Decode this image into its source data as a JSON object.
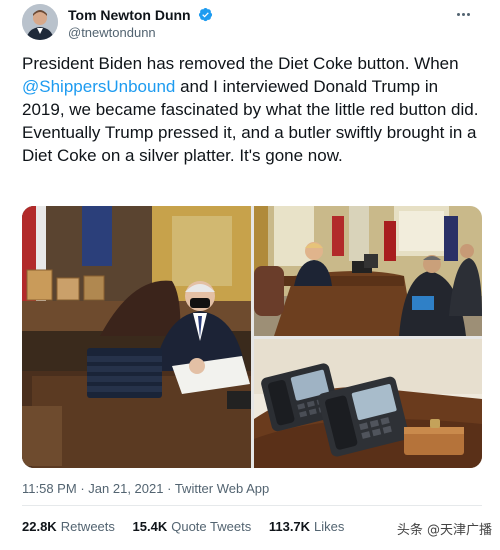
{
  "author": {
    "display_name": "Tom Newton Dunn",
    "handle": "@tnewtondunn",
    "verified": true
  },
  "tweet": {
    "text_before_mention": "President Biden has removed the Diet Coke button. When ",
    "mention": "@ShippersUnbound",
    "text_after_mention": " and I interviewed Donald Trump in 2019, we became fascinated by what the little red button did. Eventually Trump pressed it, and a butler swiftly brought in a Diet Coke on a silver platter. It's gone now."
  },
  "meta": {
    "time": "11:58 PM",
    "separator": "·",
    "date": "Jan 21, 2021",
    "source": "Twitter Web App"
  },
  "stats": {
    "retweets_count": "22.8K",
    "retweets_label": "Retweets",
    "quotes_count": "15.4K",
    "quotes_label": "Quote Tweets",
    "likes_count": "113.7K",
    "likes_label": "Likes"
  },
  "watermark": {
    "text": "头条 @天津广播"
  },
  "icons": {
    "verified": "verified-badge-icon",
    "more": "more-options-icon"
  },
  "colors": {
    "link": "#1d9bf0",
    "secondary_text": "#536471",
    "primary_text": "#0f1419"
  }
}
